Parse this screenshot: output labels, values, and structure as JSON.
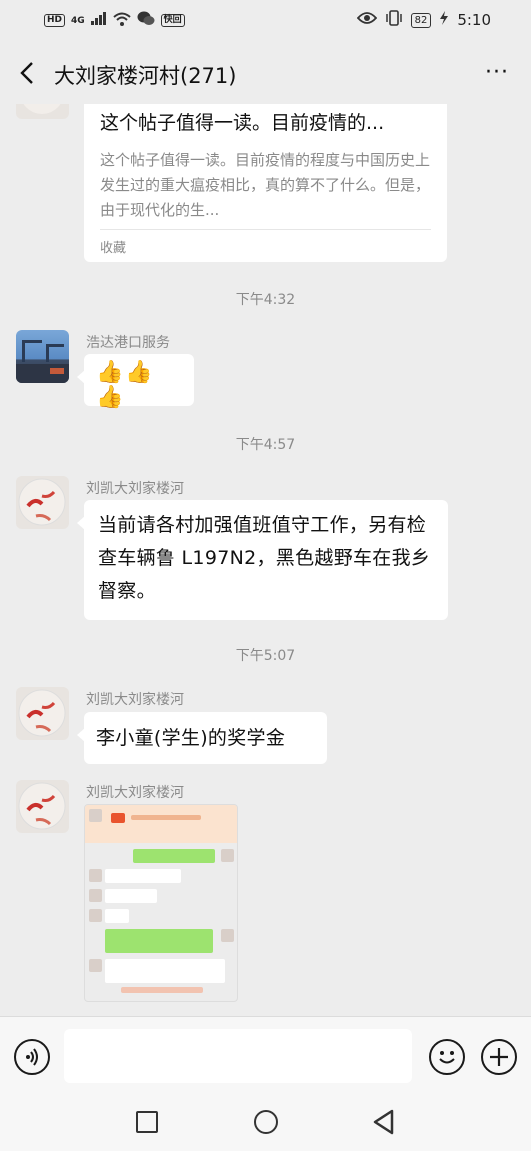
{
  "status_bar": {
    "network": "HD",
    "signal": "4G",
    "fast_badge": "快回",
    "battery": "82",
    "time": "5:10"
  },
  "header": {
    "title": "大刘家楼河村(271)",
    "more": "···"
  },
  "messages": {
    "card": {
      "title": "这个帖子值得一读。目前疫情的...",
      "description": "这个帖子值得一读。目前疫情的程度与中国历史上发生过的重大瘟疫相比，真的算不了什么。但是，由于现代化的生...",
      "source": "收藏"
    },
    "time1": "下午4:32",
    "msg1": {
      "sender": "浩达港口服务",
      "thumbs": "👍👍👍"
    },
    "time2": "下午4:57",
    "msg2": {
      "sender": "刘凯大刘家楼河",
      "text": "当前请各村加强值班值守工作，另有检查车辆鲁 L197N2，黑色越野车在我乡督察。"
    },
    "time3": "下午5:07",
    "msg3": {
      "sender": "刘凯大刘家楼河",
      "text": "李小童(学生)的奖学金"
    },
    "msg4": {
      "sender": "刘凯大刘家楼河"
    }
  },
  "icons": {
    "back": "chevron-left-icon",
    "voice": "voice-icon",
    "emoji": "emoji-icon",
    "plus": "plus-icon"
  },
  "colors": {
    "background": "#ededed",
    "bubble": "#ffffff",
    "secondary_text": "#8a8a8a",
    "wechat_green": "#95ec69"
  }
}
